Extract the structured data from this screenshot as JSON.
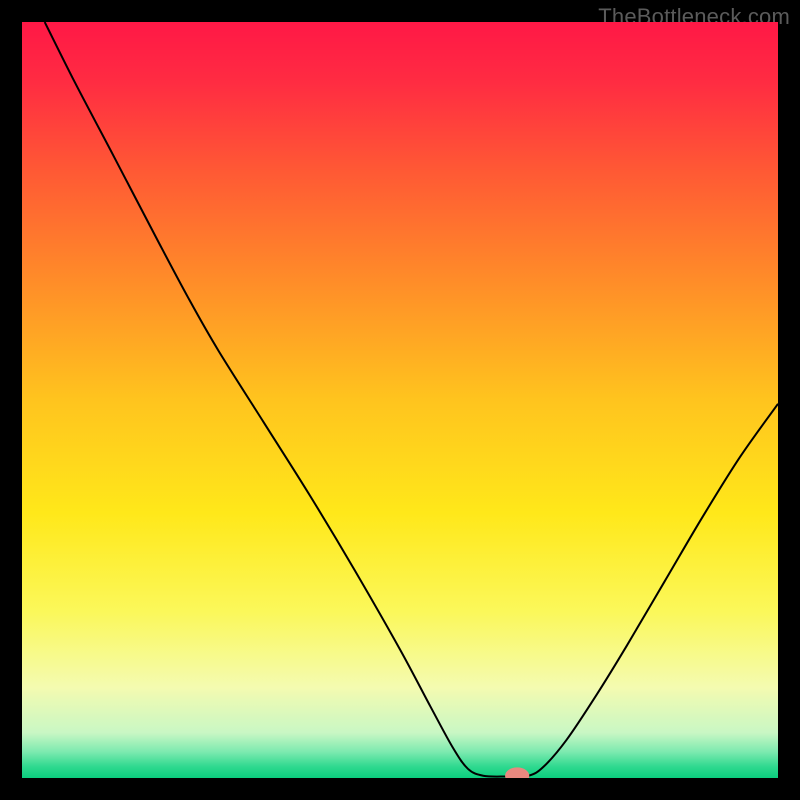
{
  "attribution": "TheBottleneck.com",
  "chart_data": {
    "type": "line",
    "title": "",
    "xlabel": "",
    "ylabel": "",
    "xlim": [
      0,
      100
    ],
    "ylim": [
      0,
      100
    ],
    "background_gradient": {
      "stops": [
        {
          "offset": 0.0,
          "color": "#ff1846"
        },
        {
          "offset": 0.08,
          "color": "#ff2c42"
        },
        {
          "offset": 0.2,
          "color": "#ff5a34"
        },
        {
          "offset": 0.35,
          "color": "#ff8f28"
        },
        {
          "offset": 0.5,
          "color": "#ffc41e"
        },
        {
          "offset": 0.65,
          "color": "#ffe81a"
        },
        {
          "offset": 0.78,
          "color": "#fbf85a"
        },
        {
          "offset": 0.88,
          "color": "#f4fbb0"
        },
        {
          "offset": 0.94,
          "color": "#c9f7c4"
        },
        {
          "offset": 0.965,
          "color": "#7eeab0"
        },
        {
          "offset": 0.985,
          "color": "#2fd98f"
        },
        {
          "offset": 1.0,
          "color": "#0bce7e"
        }
      ]
    },
    "series": [
      {
        "name": "bottleneck-curve",
        "color": "#000000",
        "points": [
          {
            "x": 3.0,
            "y": 100.0
          },
          {
            "x": 7.0,
            "y": 92.0
          },
          {
            "x": 12.0,
            "y": 82.5
          },
          {
            "x": 18.0,
            "y": 71.0
          },
          {
            "x": 22.0,
            "y": 63.5
          },
          {
            "x": 26.0,
            "y": 56.5
          },
          {
            "x": 32.0,
            "y": 47.0
          },
          {
            "x": 38.0,
            "y": 37.5
          },
          {
            "x": 44.0,
            "y": 27.5
          },
          {
            "x": 50.0,
            "y": 17.0
          },
          {
            "x": 54.0,
            "y": 9.5
          },
          {
            "x": 57.0,
            "y": 4.0
          },
          {
            "x": 59.0,
            "y": 1.2
          },
          {
            "x": 61.0,
            "y": 0.3
          },
          {
            "x": 64.0,
            "y": 0.2
          },
          {
            "x": 67.0,
            "y": 0.3
          },
          {
            "x": 69.0,
            "y": 1.5
          },
          {
            "x": 72.0,
            "y": 5.0
          },
          {
            "x": 76.0,
            "y": 11.0
          },
          {
            "x": 80.0,
            "y": 17.5
          },
          {
            "x": 85.0,
            "y": 26.0
          },
          {
            "x": 90.0,
            "y": 34.5
          },
          {
            "x": 95.0,
            "y": 42.5
          },
          {
            "x": 100.0,
            "y": 49.5
          }
        ]
      }
    ],
    "marker": {
      "name": "optimal-point",
      "x": 65.5,
      "y": 0.3,
      "color": "#e8887f",
      "rx": 1.6,
      "ry": 1.1
    }
  }
}
